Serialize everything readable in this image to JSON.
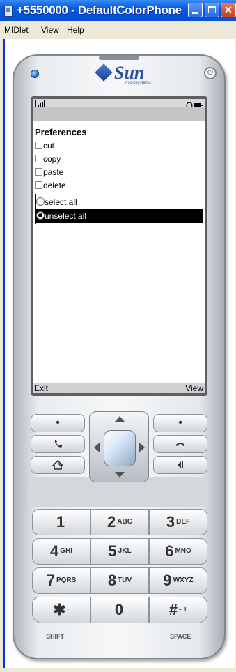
{
  "window": {
    "title": "+5550000 - DefaultColorPhone"
  },
  "menubar": {
    "items": [
      "MIDlet",
      "View",
      "Help"
    ]
  },
  "phone": {
    "logo_text": "Sun",
    "logo_sub": "microsystems",
    "power_glyph": "⏻"
  },
  "screen": {
    "form_title": "Preferences",
    "checkboxes": [
      {
        "label": "cut",
        "checked": false
      },
      {
        "label": "copy",
        "checked": false
      },
      {
        "label": "paste",
        "checked": false
      },
      {
        "label": "delete",
        "checked": false
      }
    ],
    "radios": [
      {
        "label": "select all",
        "selected": false
      },
      {
        "label": "unselect all",
        "selected": true
      }
    ],
    "soft_left": "Exit",
    "soft_right": "View"
  },
  "nav_keys": {
    "left": [
      "•",
      "call",
      "home"
    ],
    "right": [
      "•",
      "end",
      "back"
    ]
  },
  "keypad": {
    "keys": [
      {
        "digit": "1",
        "letters": ""
      },
      {
        "digit": "2",
        "letters": "ABC"
      },
      {
        "digit": "3",
        "letters": "DEF"
      },
      {
        "digit": "4",
        "letters": "GHI"
      },
      {
        "digit": "5",
        "letters": "JKL"
      },
      {
        "digit": "6",
        "letters": "MNO"
      },
      {
        "digit": "7",
        "letters": "PQRS"
      },
      {
        "digit": "8",
        "letters": "TUV"
      },
      {
        "digit": "9",
        "letters": "WXYZ"
      },
      {
        "digit": "✱",
        "letters": "·"
      },
      {
        "digit": "0",
        "letters": ""
      },
      {
        "digit": "#",
        "letters": "- +"
      }
    ],
    "shift_label": "SHIFT",
    "space_label": "SPACE"
  },
  "colors": {
    "titlebar": "#0054e3",
    "selection": "#000000",
    "softbar": "#d0d0d0"
  }
}
